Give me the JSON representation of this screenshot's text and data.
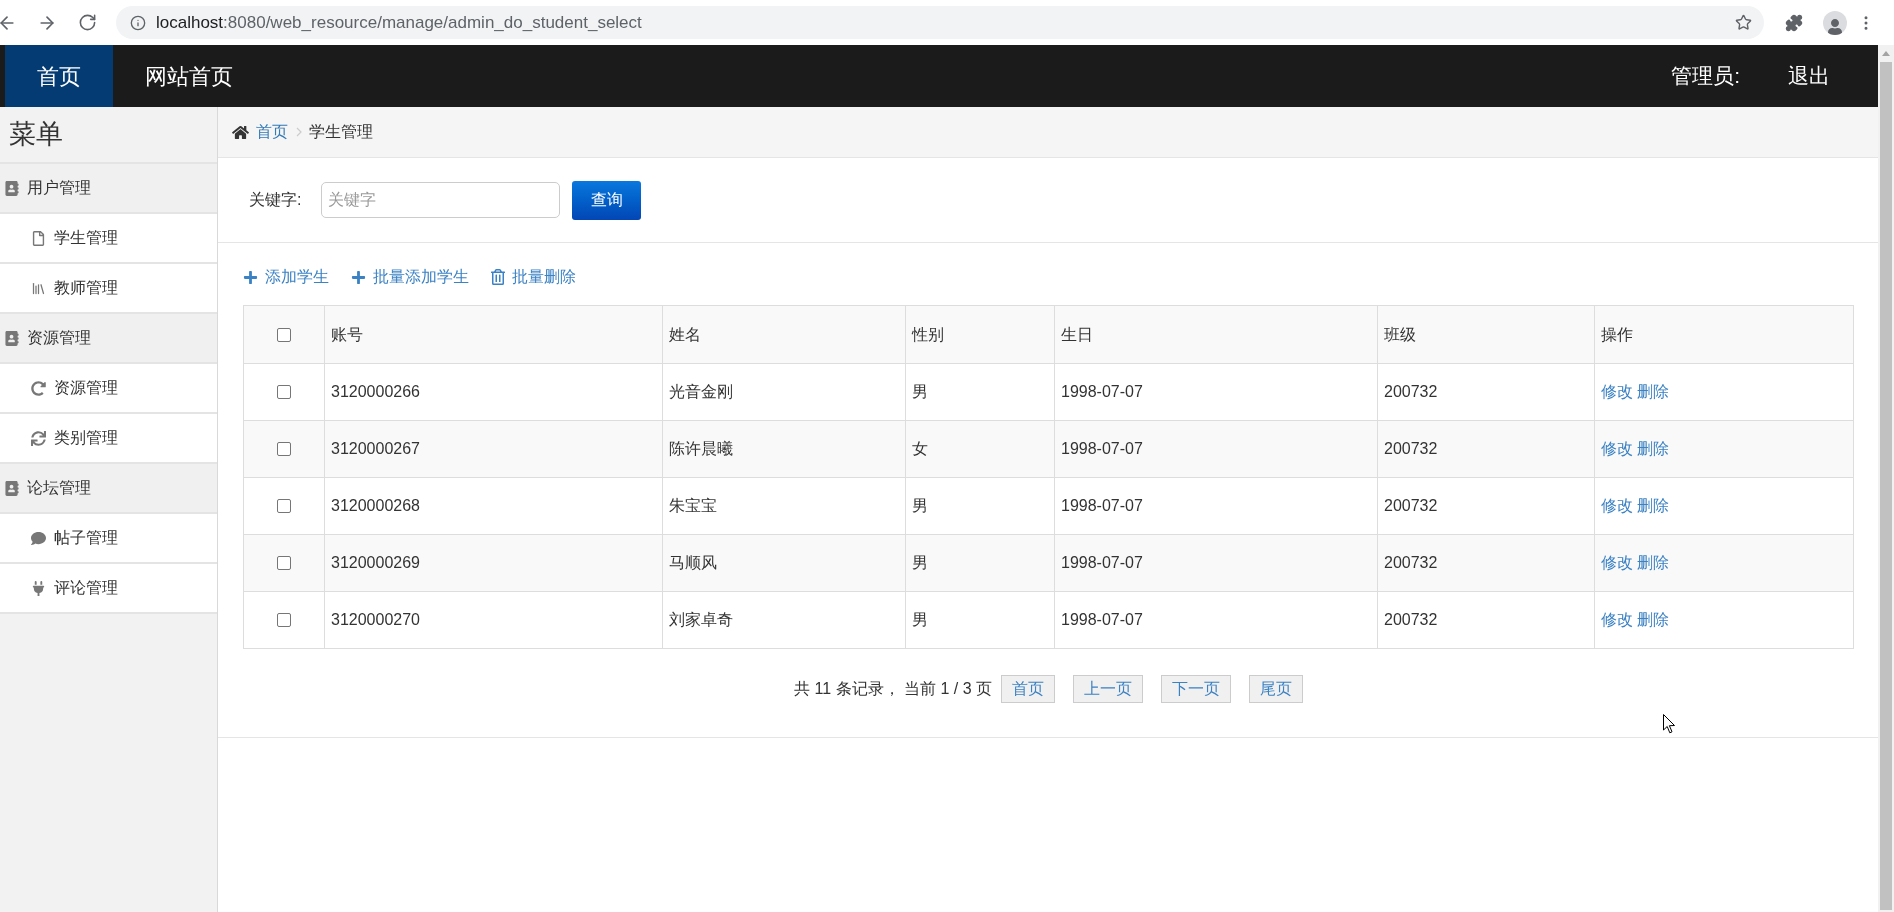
{
  "browser": {
    "url_host": "localhost",
    "url_rest": ":8080/web_resource/manage/admin_do_student_select"
  },
  "top_nav": {
    "items": [
      {
        "label": "首页",
        "selected": true
      },
      {
        "label": "网站首页",
        "selected": false
      }
    ],
    "user_label": "管理员:",
    "logout": "退出"
  },
  "sidebar": {
    "title": "菜单",
    "groups": [
      {
        "label": "用户管理",
        "children": [
          {
            "label": "学生管理"
          },
          {
            "label": "教师管理"
          }
        ]
      },
      {
        "label": "资源管理",
        "children": [
          {
            "label": "资源管理"
          },
          {
            "label": "类别管理"
          }
        ]
      },
      {
        "label": "论坛管理",
        "children": [
          {
            "label": "帖子管理"
          },
          {
            "label": "评论管理"
          }
        ]
      }
    ]
  },
  "breadcrumb": {
    "home": "首页",
    "current": "学生管理"
  },
  "search": {
    "label": "关键字:",
    "placeholder": "关键字",
    "button": "查询"
  },
  "toolbar": [
    {
      "kind": "add",
      "label": "添加学生"
    },
    {
      "kind": "add",
      "label": "批量添加学生"
    },
    {
      "kind": "delete",
      "label": "批量删除"
    }
  ],
  "table": {
    "select_all_checked": false,
    "columns": [
      "账号",
      "姓名",
      "性别",
      "生日",
      "班级",
      "操作"
    ],
    "rows": [
      {
        "checked": false,
        "cells": [
          "3120000266",
          "光音金刚",
          "男",
          "1998-07-07",
          "200732"
        ],
        "actions": [
          "修改",
          "删除"
        ]
      },
      {
        "checked": false,
        "cells": [
          "3120000267",
          "陈许晨曦",
          "女",
          "1998-07-07",
          "200732"
        ],
        "actions": [
          "修改",
          "删除"
        ]
      },
      {
        "checked": false,
        "cells": [
          "3120000268",
          "朱宝宝",
          "男",
          "1998-07-07",
          "200732"
        ],
        "actions": [
          "修改",
          "删除"
        ]
      },
      {
        "checked": false,
        "cells": [
          "3120000269",
          "马顺风",
          "男",
          "1998-07-07",
          "200732"
        ],
        "actions": [
          "修改",
          "删除"
        ]
      },
      {
        "checked": false,
        "cells": [
          "3120000270",
          "刘家卓奇",
          "男",
          "1998-07-07",
          "200732"
        ],
        "actions": [
          "修改",
          "删除"
        ]
      }
    ]
  },
  "pagination": {
    "summary": "共 11 条记录， 当前 1 / 3 页",
    "buttons": [
      "首页",
      "上一页",
      "下一页",
      "尾页"
    ]
  }
}
